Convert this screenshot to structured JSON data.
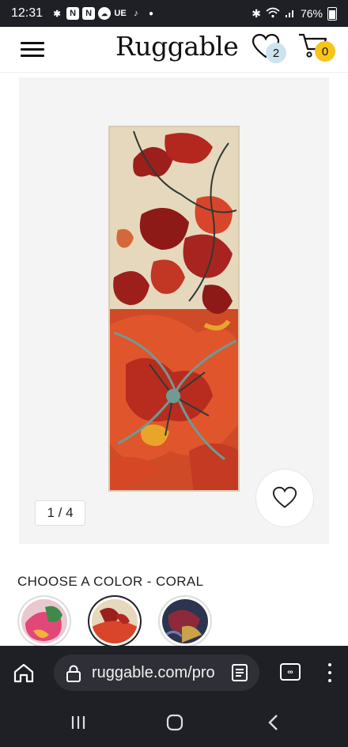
{
  "status_bar": {
    "time": "12:31",
    "app_icons": [
      "slack-icon",
      "n-icon",
      "n-icon",
      "cloud-icon",
      "ue-icon",
      "tiktok-icon"
    ],
    "ue_label": "UE",
    "battery": "76%"
  },
  "header": {
    "logo": "Ruggable",
    "wishlist_count": "2",
    "cart_count": "0"
  },
  "gallery": {
    "counter": "1 / 4",
    "colors": {
      "rug_base": "#e6d8bd",
      "petal_dark": "#9c1f1c",
      "petal_bright": "#d8452a",
      "accent_yellow": "#e8a52a",
      "teal": "#6f9a95"
    }
  },
  "color_chooser": {
    "title": "CHOOSE A COLOR - CORAL",
    "swatches": [
      {
        "name": "pink",
        "selected": false
      },
      {
        "name": "coral",
        "selected": true
      },
      {
        "name": "navy",
        "selected": false
      }
    ]
  },
  "browser": {
    "url": "ruggable.com/pro",
    "tabs_label": "∞"
  }
}
